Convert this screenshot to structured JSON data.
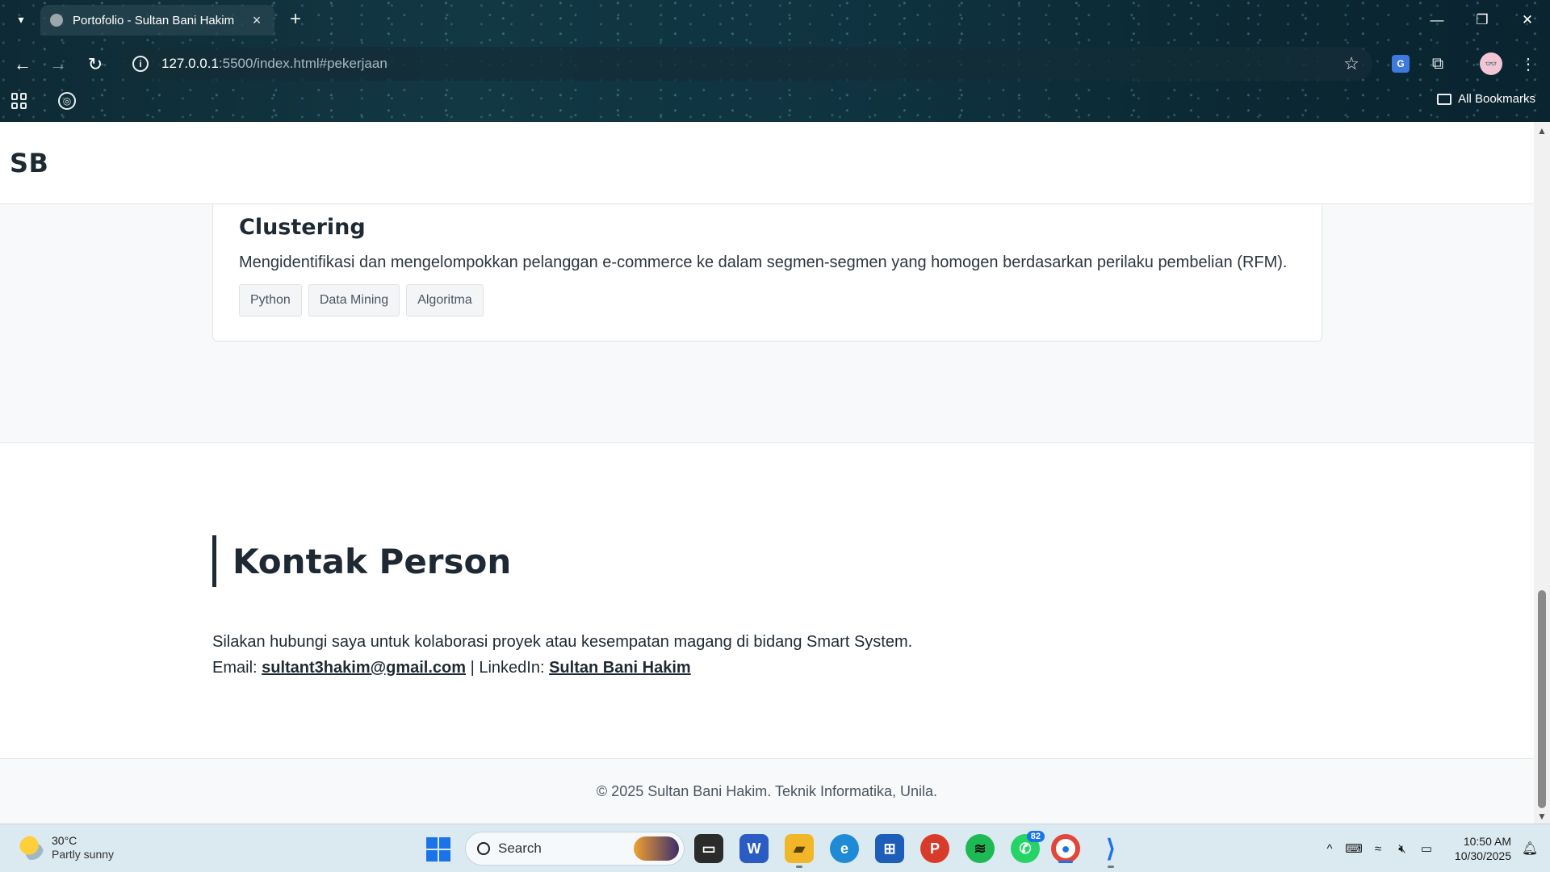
{
  "browser": {
    "tab_title": "Portofolio - Sultan Bani Hakim",
    "url_host": "127.0.0.1",
    "url_rest": ":5500/index.html#pekerjaan",
    "all_bookmarks": "All Bookmarks",
    "profile_initials": "👓"
  },
  "site": {
    "logo": "SB",
    "project": {
      "title": "Clustering",
      "description": "Mengidentifikasi dan mengelompokkan pelanggan e-commerce ke dalam segmen-segmen yang homogen berdasarkan perilaku pembelian (RFM).",
      "tags": [
        "Python",
        "Data Mining",
        "Algoritma"
      ]
    },
    "contact": {
      "heading": "Kontak Person",
      "intro": "Silakan hubungi saya untuk kolaborasi proyek atau kesempatan magang di bidang Smart System.",
      "email_label": "Email: ",
      "email": "sultant3hakim@gmail.com",
      "separator": " | LinkedIn: ",
      "linkedin": "Sultan Bani Hakim"
    },
    "footer": "© 2025 Sultan Bani Hakim. Teknik Informatika, Unila."
  },
  "taskbar": {
    "weather_temp": "30°C",
    "weather_desc": "Partly sunny",
    "search_label": "Search",
    "whatsapp_badge": "82",
    "time": "10:50 AM",
    "date": "10/30/2025"
  },
  "colors": {
    "accent": "#1f2933",
    "page_bg": "#f8f9fa",
    "windows_blue": "#1a73e8"
  }
}
